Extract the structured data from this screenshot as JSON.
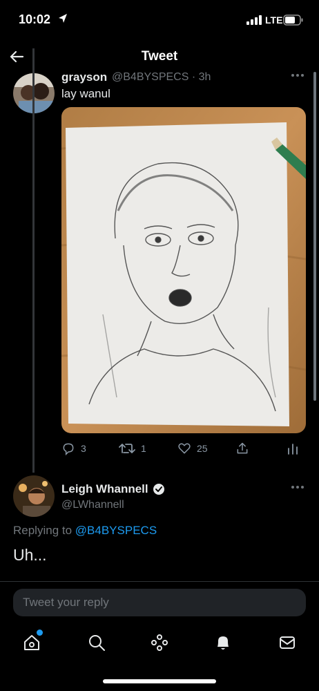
{
  "status_bar": {
    "time": "10:02",
    "network": "LTE"
  },
  "nav": {
    "title": "Tweet",
    "back_icon": "arrow-left-icon"
  },
  "tweet": {
    "author_name": "grayson",
    "handle_time": "@B4BYSPECS · 3h",
    "text": "lay wanul",
    "photo": "pencil-sketch-portrait",
    "stats": {
      "replies": "3",
      "retweets": "1",
      "likes": "25"
    }
  },
  "reply": {
    "author_name": "Leigh Whannell",
    "verified": true,
    "handle": "@LWhannell",
    "replying_prefix": "Replying to",
    "replying_to": "@B4BYSPECS",
    "text": "Uh..."
  },
  "composer": {
    "placeholder": "Tweet your reply"
  },
  "tabs": [
    "home-icon",
    "search-icon",
    "spaces-icon",
    "notifications-icon",
    "messages-icon"
  ],
  "colors": {
    "accent": "#1d9bf0",
    "background": "#000000",
    "muted": "#71767b"
  }
}
